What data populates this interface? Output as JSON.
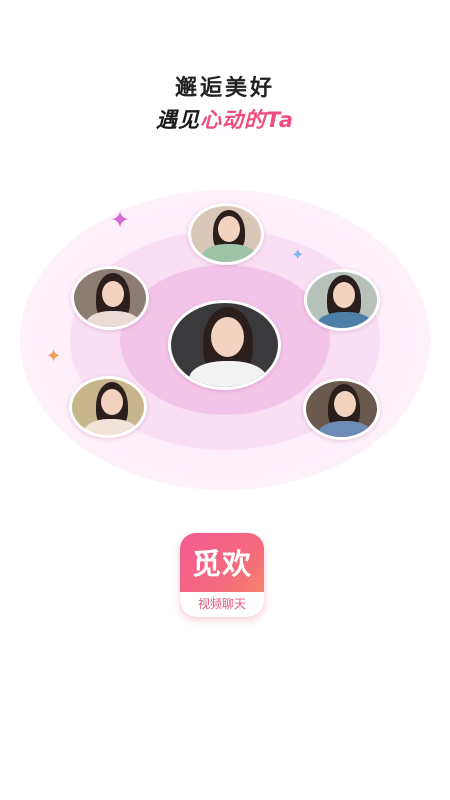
{
  "headline": {
    "line1": "邂逅美好",
    "line2_dark": "遇见",
    "line2_pink": "心动的Ta"
  },
  "colors": {
    "accent_pink": "#f04d7c",
    "logo_gradient_start": "#f35b94",
    "logo_gradient_end": "#f79064",
    "ring_tint": "#f1bde6"
  },
  "avatars": [
    {
      "name": "avatar-top",
      "outfit": "#9fc3a8"
    },
    {
      "name": "avatar-upper-left",
      "outfit": "#e9dcd6"
    },
    {
      "name": "avatar-upper-right",
      "outfit": "#4d7fa8"
    },
    {
      "name": "avatar-center",
      "outfit": "#f2f2f2"
    },
    {
      "name": "avatar-lower-left",
      "outfit": "#f0e4da"
    },
    {
      "name": "avatar-lower-right",
      "outfit": "#6c8bb5"
    }
  ],
  "sparkles": [
    {
      "icon": "sparkle-icon",
      "color": "#d86bd3"
    },
    {
      "icon": "sparkle-icon",
      "color": "#7fb5f2"
    },
    {
      "icon": "sparkle-icon",
      "color": "#f29a5a"
    }
  ],
  "logo": {
    "mark": "觅欢",
    "tagline": "视频聊天"
  }
}
